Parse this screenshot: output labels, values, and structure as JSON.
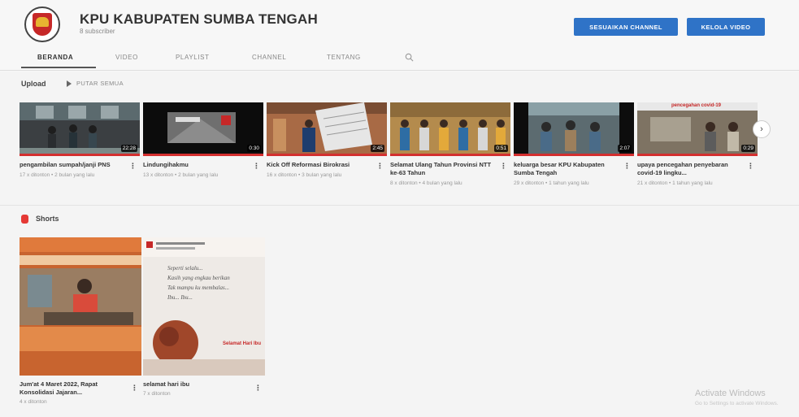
{
  "channel": {
    "name": "KPU KABUPATEN SUMBA TENGAH",
    "subscribers": "8 subscriber",
    "customize_label": "SESUAIKAN CHANNEL",
    "manage_label": "KELOLA VIDEO"
  },
  "tabs": [
    "BERANDA",
    "VIDEO",
    "PLAYLIST",
    "CHANNEL",
    "TENTANG"
  ],
  "upload": {
    "label": "Upload",
    "play_all": "PUTAR SEMUA",
    "videos": [
      {
        "title": "pengambilan sumpah/janji PNS",
        "meta": "17 x ditonton • 2 bulan yang lalu",
        "duration": "22:28"
      },
      {
        "title": "Lindungihakmu",
        "meta": "13 x ditonton • 2 bulan yang lalu",
        "duration": "0:30"
      },
      {
        "title": "Kick Off Reformasi Birokrasi",
        "meta": "16 x ditonton • 3 bulan yang lalu",
        "duration": "2:45"
      },
      {
        "title": "Selamat Ulang Tahun Provinsi NTT ke-63 Tahun",
        "meta": "8 x ditonton • 4 bulan yang lalu",
        "duration": "0:51"
      },
      {
        "title": "keluarga besar KPU Kabupaten Sumba Tengah",
        "meta": "29 x ditonton • 1 tahun yang lalu",
        "duration": "2:07"
      },
      {
        "title": "upaya pencegahan penyebaran covid-19 lingku...",
        "meta": "21 x ditonton • 1 tahun yang lalu",
        "duration": "0:29"
      }
    ],
    "thumb_banner_6": "pencegahan covid-19"
  },
  "shorts": {
    "label": "Shorts",
    "items": [
      {
        "title": "Jum'at 4 Maret 2022, Rapat Konsolidasi Jajaran...",
        "meta": "4 x ditonton"
      },
      {
        "title": "selamat hari ibu",
        "meta": "7 x ditonton"
      }
    ],
    "poem_lines": [
      "Seperti selalu...",
      "Kasih yang engkau berikan",
      "Tak mampu ku membalas...",
      "Ibu... Ibu...",
      "Selamat Hari Ibu"
    ]
  },
  "watermark": {
    "title": "Activate Windows",
    "subtitle": "Go to Settings to activate Windows."
  }
}
